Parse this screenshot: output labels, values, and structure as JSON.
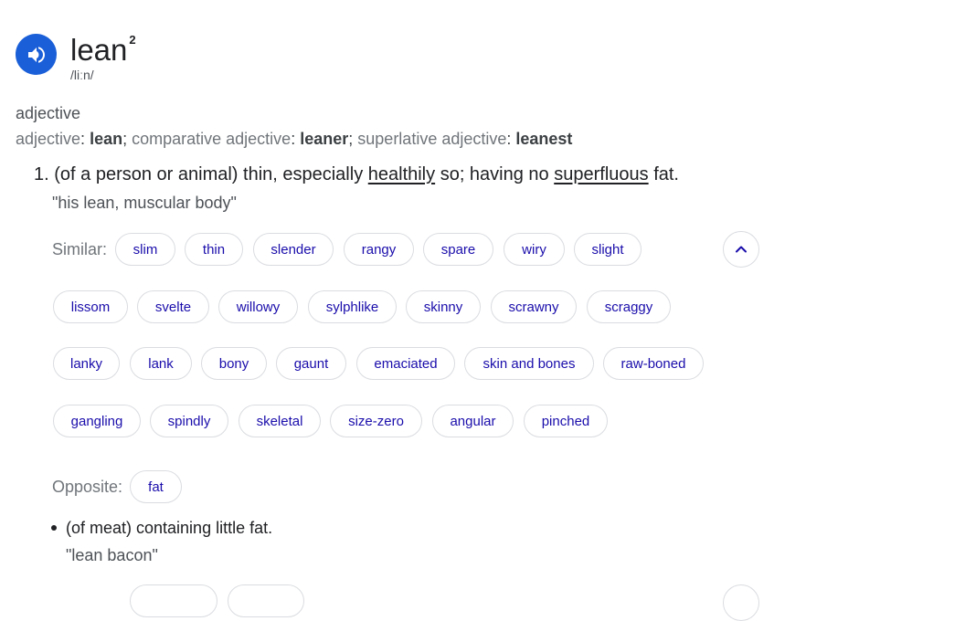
{
  "entry": {
    "headword": "lean",
    "superscript": "2",
    "phonetic": "/liːn/",
    "pronounce_icon": "speaker-icon"
  },
  "part_of_speech": "adjective",
  "forms": [
    {
      "label": "adjective",
      "value": "lean"
    },
    {
      "label": "comparative adjective",
      "value": "leaner"
    },
    {
      "label": "superlative adjective",
      "value": "leanest"
    }
  ],
  "sense1": {
    "number": "1.",
    "pre": "(of a person or animal) thin, especially ",
    "link1": "healthily",
    "mid": " so; having no ",
    "link2": "superfluous",
    "post": " fat.",
    "example": "\"his lean, muscular body\"",
    "similar_label": "Similar:",
    "similar_rows": [
      [
        "slim",
        "thin",
        "slender",
        "rangy",
        "spare",
        "wiry",
        "slight"
      ],
      [
        "lissom",
        "svelte",
        "willowy",
        "sylphlike",
        "skinny",
        "scrawny",
        "scraggy"
      ],
      [
        "lanky",
        "lank",
        "bony",
        "gaunt",
        "emaciated",
        "skin and bones",
        "raw-boned"
      ],
      [
        "gangling",
        "spindly",
        "skeletal",
        "size-zero",
        "angular",
        "pinched"
      ]
    ],
    "opposite_label": "Opposite:",
    "opposites": [
      "fat"
    ]
  },
  "sense2": {
    "text": "(of meat) containing little fat.",
    "example": "\"lean bacon\""
  },
  "colors": {
    "accent": "#1a5fd8",
    "chip_text": "#1a0dab",
    "chip_border": "#dadce0"
  }
}
